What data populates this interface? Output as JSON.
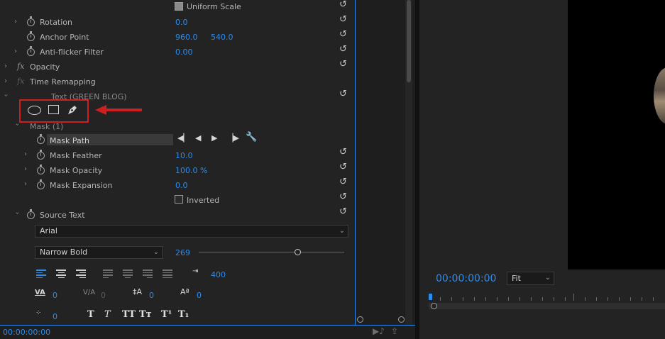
{
  "effect_controls": {
    "uniform_scale_label": "Uniform Scale",
    "rotation": {
      "label": "Rotation",
      "value": "0.0"
    },
    "anchor_point": {
      "label": "Anchor Point",
      "x": "960.0",
      "y": "540.0"
    },
    "anti_flicker": {
      "label": "Anti-flicker Filter",
      "value": "0.00"
    },
    "opacity_label": "Opacity",
    "time_remapping_label": "Time Remapping",
    "text_layer_label": "Text (GREEN BLOG)",
    "mask_label": "Mask (1)",
    "mask_path_label": "Mask Path",
    "mask_feather": {
      "label": "Mask Feather",
      "value": "10.0"
    },
    "mask_opacity": {
      "label": "Mask Opacity",
      "value": "100.0 %"
    },
    "mask_expansion": {
      "label": "Mask Expansion",
      "value": "0.0"
    },
    "inverted_label": "Inverted",
    "source_text_label": "Source Text",
    "font_family": "Arial",
    "font_style": "Narrow Bold",
    "font_size": "269",
    "tab_value": "400",
    "kerning": "0",
    "tracking": "0",
    "leading": "0",
    "baseline_shift": "0",
    "tsume": "0",
    "text_style_buttons": [
      "T",
      "T",
      "TT",
      "Tт",
      "T¹",
      "T₁"
    ]
  },
  "footer": {
    "timecode": "00:00:00:00"
  },
  "monitor": {
    "timecode": "00:00:00:00",
    "zoom": "Fit"
  },
  "colors": {
    "accent": "#2d8ceb",
    "highlight": "#cc1f1f"
  }
}
